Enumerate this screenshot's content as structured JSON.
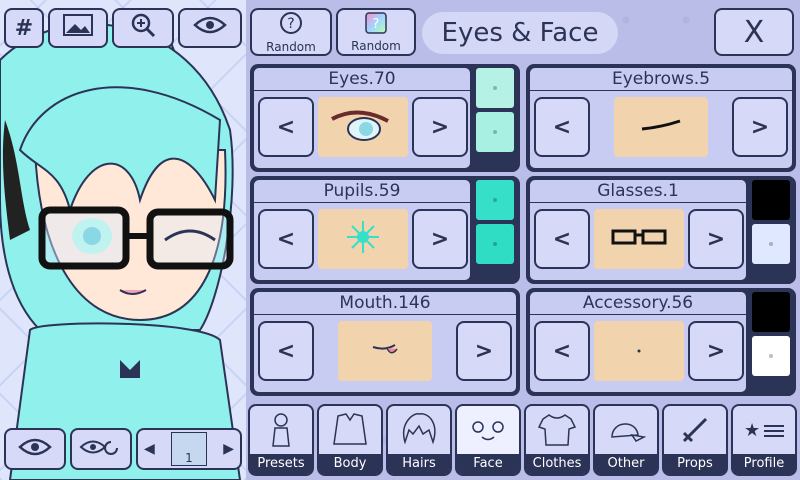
{
  "top_toolbar": {
    "grid_label": "#",
    "random_buttons": [
      {
        "label": "Random"
      },
      {
        "label": "Random"
      }
    ]
  },
  "header": {
    "title": "Eyes & Face",
    "close_label": "X"
  },
  "cards": {
    "eyes": {
      "label": "Eyes.70",
      "colors": [
        "#b6f1e6",
        "#a7f0e2"
      ]
    },
    "eyebrows": {
      "label": "Eyebrows.5"
    },
    "pupils": {
      "label": "Pupils.59",
      "colors": [
        "#36e0c8",
        "#2fdcc4"
      ]
    },
    "glasses": {
      "label": "Glasses.1",
      "colors": [
        "#000000",
        "#dfe8ff"
      ]
    },
    "mouth": {
      "label": "Mouth.146"
    },
    "accessory": {
      "label": "Accessory.56",
      "colors": [
        "#000000",
        "#ffffff"
      ]
    }
  },
  "arrows": {
    "prev": "<",
    "next": ">"
  },
  "tabs": [
    {
      "label": "Presets",
      "icon": "figure-icon"
    },
    {
      "label": "Body",
      "icon": "body-icon"
    },
    {
      "label": "Hairs",
      "icon": "hair-icon"
    },
    {
      "label": "Face",
      "icon": "face-icon",
      "active": true
    },
    {
      "label": "Clothes",
      "icon": "shirt-icon"
    },
    {
      "label": "Other",
      "icon": "cap-icon"
    },
    {
      "label": "Props",
      "icon": "sword-icon"
    },
    {
      "label": "Profile",
      "icon": "profile-icon"
    }
  ],
  "character_slot": {
    "number": "1"
  }
}
